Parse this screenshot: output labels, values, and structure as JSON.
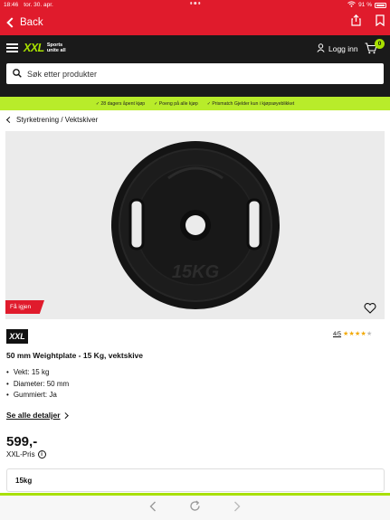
{
  "status": {
    "time": "18:46",
    "date": "tor. 30. apr.",
    "battery": "91 %"
  },
  "navbar": {
    "back_label": "Back",
    "share_icon": "share-icon",
    "bookmark_icon": "bookmark-icon"
  },
  "header": {
    "logo_text": "XXL",
    "logo_tagline_1": "Sports",
    "logo_tagline_2": "unite all",
    "login_label": "Logg inn",
    "cart_count": "0"
  },
  "search": {
    "placeholder": "Søk etter produkter"
  },
  "usp": {
    "items": [
      "28 dagers åpent kjøp",
      "Poeng på alle kjøp",
      "Prismatch Gjelder kun i kjøpsøyeblikket"
    ]
  },
  "breadcrumb": {
    "label": "Styrketrening / Vektskiver"
  },
  "product": {
    "badge": "Få igjen",
    "brand": "XXL",
    "rating_score": "4/5",
    "rating_value": 4,
    "rating_max": 5,
    "title": "50 mm Weightplate - 15 Kg, vektskive",
    "specs": [
      "Vekt: 15 kg",
      "Diameter: 50 mm",
      "Gummiert: Ja"
    ],
    "details_link": "Se alle detaljer",
    "price": "599,-",
    "price_label": "XXL-Pris",
    "variant": "15kg",
    "plate_text": "15KG"
  },
  "colors": {
    "brand_red": "#e01b2c",
    "brand_green": "#a8e000",
    "usp_green": "#b8ec2a"
  }
}
